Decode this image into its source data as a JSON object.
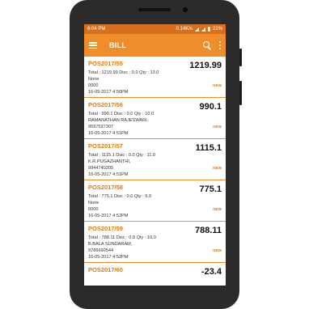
{
  "status": {
    "time": "6:04 PM",
    "net": "0.14K/s",
    "battery": "21%"
  },
  "appbar": {
    "title": "BILL"
  },
  "bills": [
    {
      "id": "POS2017/55",
      "amount": "1219.99",
      "summary": "Total : 1219.99 Disc : 0.0 Qty : 13.0",
      "customer": "None",
      "phone": "0000",
      "date": "16-05-2017 4:50PM",
      "badge": "NEW"
    },
    {
      "id": "POS2017/56",
      "amount": "990.1",
      "summary": "Total : 990.1 Disc : 0.0 Qty : 10.0",
      "customer": "RAMANATHAN RAJESWARI,",
      "phone": "9597537307",
      "date": "16-05-2017 4:51PM",
      "badge": "NEW"
    },
    {
      "id": "POS2017/57",
      "amount": "1115.1",
      "summary": "Total : 1115.1 Disc : 0.0 Qty : 11.0",
      "customer": "K.R.PUGAZHANTHI,",
      "phone": "9944740205",
      "date": "16-05-2017 4:51PM",
      "badge": "NEW"
    },
    {
      "id": "POS2017/58",
      "amount": "775.1",
      "summary": "Total : 775.1 Disc : 0.0 Qty : 9.0",
      "customer": "None",
      "phone": "0000",
      "date": "16-05-2017 4:52PM",
      "badge": "NEW"
    },
    {
      "id": "POS2017/59",
      "amount": "788.11",
      "summary": "Total : 788.11 Disc : 0.0 Qty : 10.0",
      "customer": "B.BALA SUNDARAM,",
      "phone": "9786690544",
      "date": "16-05-2017 4:52PM",
      "badge": "NEW"
    },
    {
      "id": "POS2017/60",
      "amount": "-23.4",
      "summary": "",
      "customer": "",
      "phone": "",
      "date": "",
      "badge": ""
    }
  ]
}
